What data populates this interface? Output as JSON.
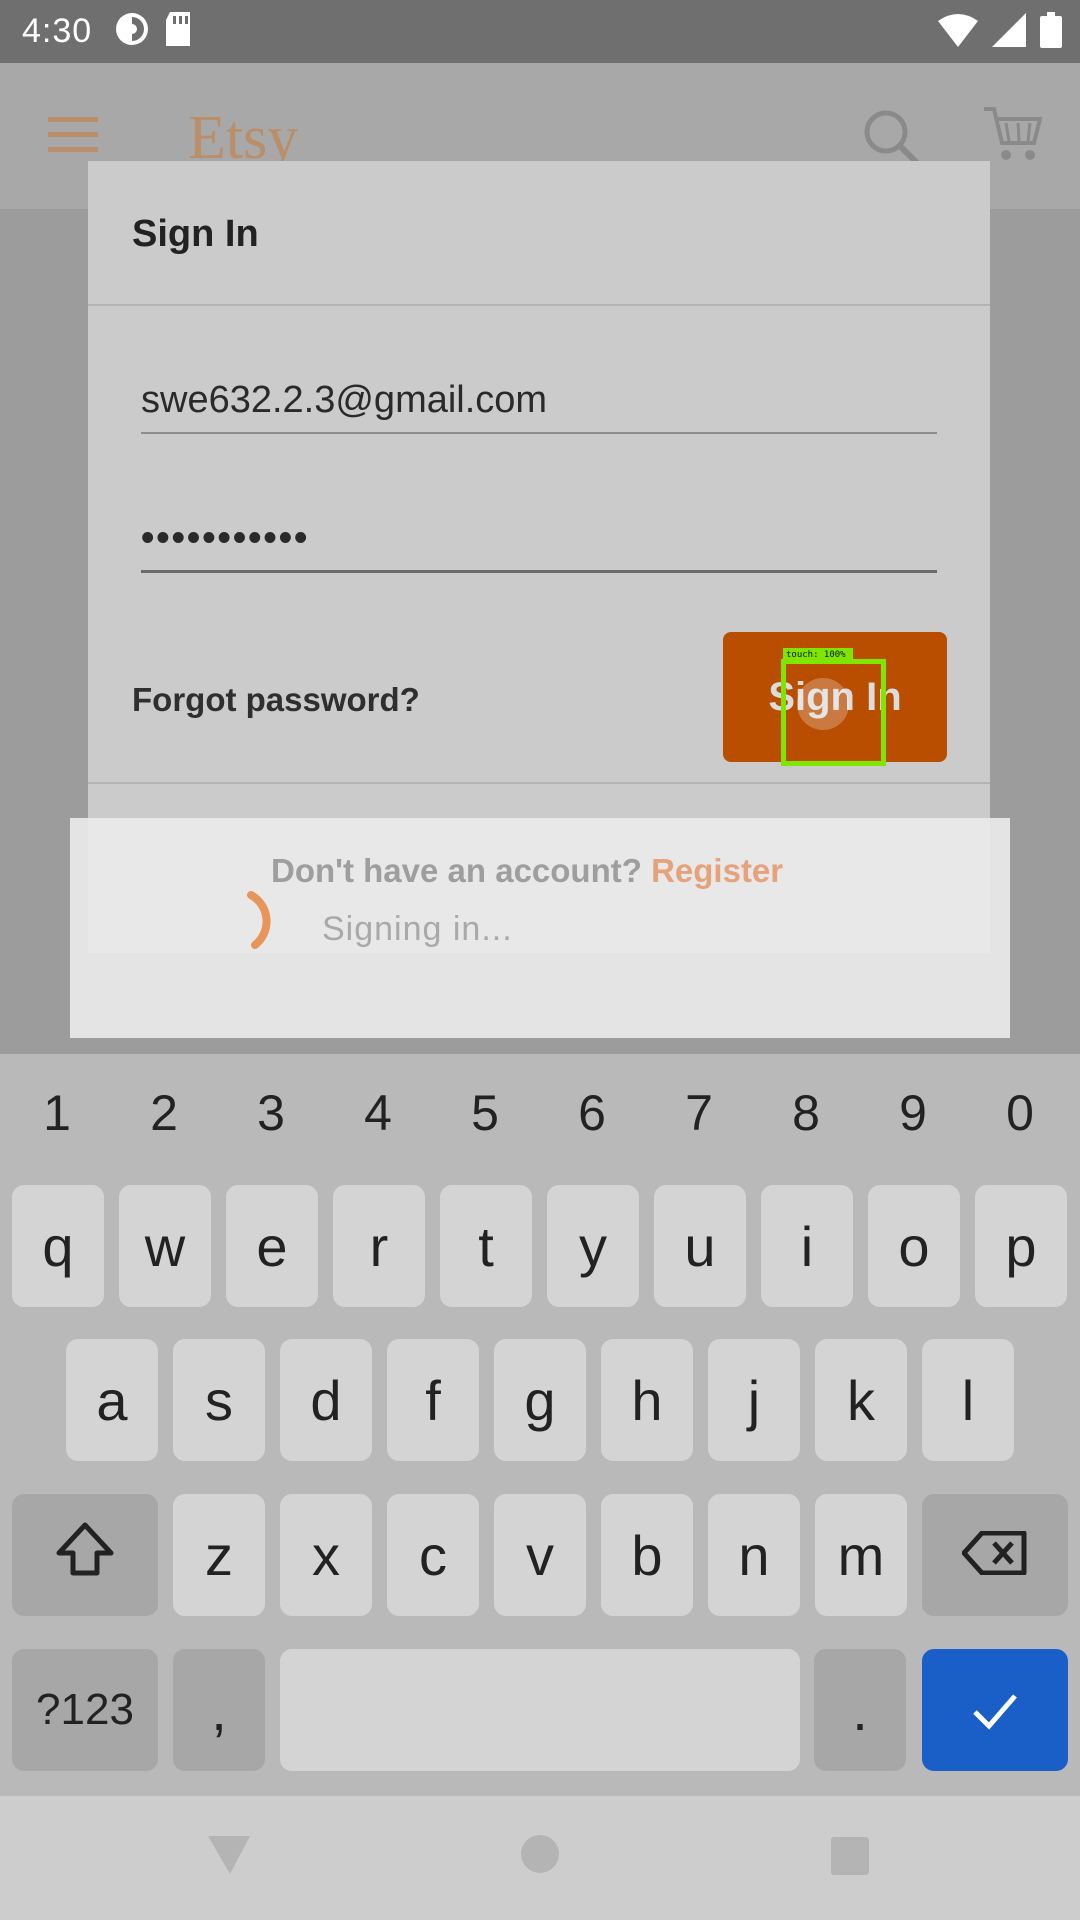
{
  "status_bar": {
    "time": "4:30",
    "icons": [
      "data-saver-icon",
      "sd-card-icon",
      "wifi-icon",
      "signal-icon",
      "battery-icon"
    ]
  },
  "app_bar": {
    "logo": "Etsy",
    "icons": [
      "menu-icon",
      "search-icon",
      "cart-icon"
    ]
  },
  "dialog": {
    "title": "Sign In",
    "email_value": "swe632.2.3@gmail.com",
    "password_value": "•••••••••••",
    "forgot_password": "Forgot password?",
    "sign_in_button": "Sign In",
    "register_prompt": "Don't have an account?",
    "register_link": "Register",
    "accent_color": "#b94e00"
  },
  "touch_overlay": {
    "label": "touch: 100%"
  },
  "progress": {
    "text": "Signing in..."
  },
  "keyboard": {
    "numbers": [
      "1",
      "2",
      "3",
      "4",
      "5",
      "6",
      "7",
      "8",
      "9",
      "0"
    ],
    "row1": [
      "q",
      "w",
      "e",
      "r",
      "t",
      "y",
      "u",
      "i",
      "o",
      "p"
    ],
    "row2": [
      "a",
      "s",
      "d",
      "f",
      "g",
      "h",
      "j",
      "k",
      "l"
    ],
    "row3": [
      "z",
      "x",
      "c",
      "v",
      "b",
      "n",
      "m"
    ],
    "symbols_key": "?123",
    "comma_key": ",",
    "period_key": ".",
    "icons": [
      "shift-icon",
      "backspace-icon",
      "check-icon"
    ]
  },
  "nav_bar": {
    "icons": [
      "back-icon",
      "home-icon",
      "recents-icon"
    ]
  }
}
